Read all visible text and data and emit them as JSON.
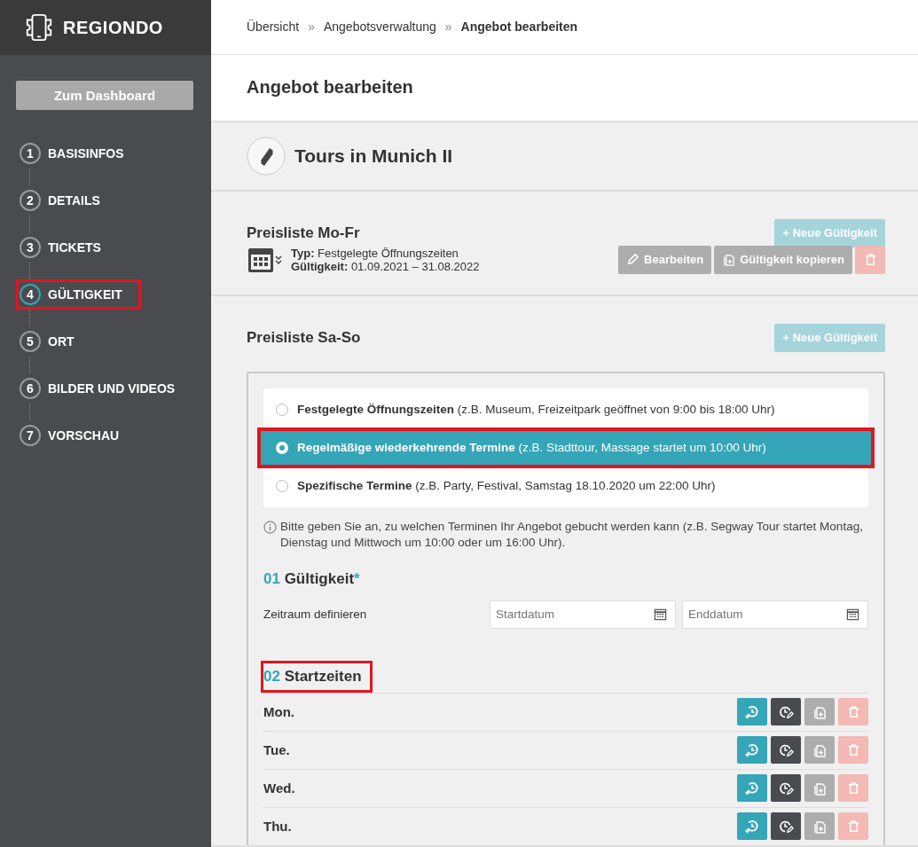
{
  "brand": "REGIONDO",
  "dashboard_button": "Zum Dashboard",
  "steps": [
    {
      "number": "1",
      "label": "BASISINFOS",
      "selected": false,
      "highlighted": false
    },
    {
      "number": "2",
      "label": "DETAILS",
      "selected": false,
      "highlighted": false
    },
    {
      "number": "3",
      "label": "TICKETS",
      "selected": false,
      "highlighted": false
    },
    {
      "number": "4",
      "label": "GÜLTIGKEIT",
      "selected": true,
      "highlighted": true
    },
    {
      "number": "5",
      "label": "ORT",
      "selected": false,
      "highlighted": false
    },
    {
      "number": "6",
      "label": "BILDER UND VIDEOS",
      "selected": false,
      "highlighted": false
    },
    {
      "number": "7",
      "label": "VORSCHAU",
      "selected": false,
      "highlighted": false
    }
  ],
  "breadcrumb": [
    {
      "kind": "link",
      "text": "Übersicht"
    },
    {
      "kind": "separator",
      "text": "»"
    },
    {
      "kind": "link",
      "text": "Angebotsverwaltung"
    },
    {
      "kind": "separator",
      "text": "»"
    },
    {
      "kind": "current",
      "text": "Angebot bearbeiten"
    }
  ],
  "page_title": "Angebot bearbeiten",
  "offer_title": "Tours in Munich II",
  "pricelists": [
    {
      "kind": "summary",
      "title": "Preisliste Mo-Fr",
      "new_button": "+ Neue Gültigkeit",
      "type_label": "Typ:",
      "type_value": "Festgelegte Öffnungszeiten",
      "validity_label": "Gültigkeit:",
      "validity_value": "01.09.2021 – 31.08.2022",
      "edit_button": "Bearbeiten",
      "copy_button": "Gültigkeit kopieren"
    },
    {
      "kind": "editor",
      "title": "Preisliste Sa-So",
      "new_button": "+ Neue Gültigkeit"
    }
  ],
  "editor": {
    "options": [
      {
        "text": "**Festgelegte Öffnungszeiten** (z.B. Museum, Freizeitpark geöffnet von 9:00 bis 18:00 Uhr)",
        "selected": false,
        "highlighted": false
      },
      {
        "text": "**Regelmäßige wiederkehrende Termine** (z.B. Stadttour, Massage startet um 10:00 Uhr)",
        "selected": true,
        "highlighted": true
      },
      {
        "text": "**Spezifische Termine** (z.B. Party, Festival, Samstag 18.10.2020 um 22:00 Uhr)",
        "selected": false,
        "highlighted": false
      }
    ],
    "info": "Bitte geben Sie an, zu welchen Terminen Ihr Angebot gebucht werden kann (z.B. Segway Tour startet Montag, Dienstag und Mittwoch um 10:00 oder um 16:00 Uhr).",
    "validity": {
      "number": "01",
      "title": "Gültigkeit",
      "required_mark": "*",
      "label": "Zeitraum definieren",
      "start_placeholder": "Startdatum",
      "end_placeholder": "Enddatum"
    },
    "start_times": {
      "number": "02",
      "title": "Startzeiten",
      "highlighted": true,
      "days": [
        "Mon.",
        "Tue.",
        "Wed.",
        "Thu."
      ]
    }
  }
}
